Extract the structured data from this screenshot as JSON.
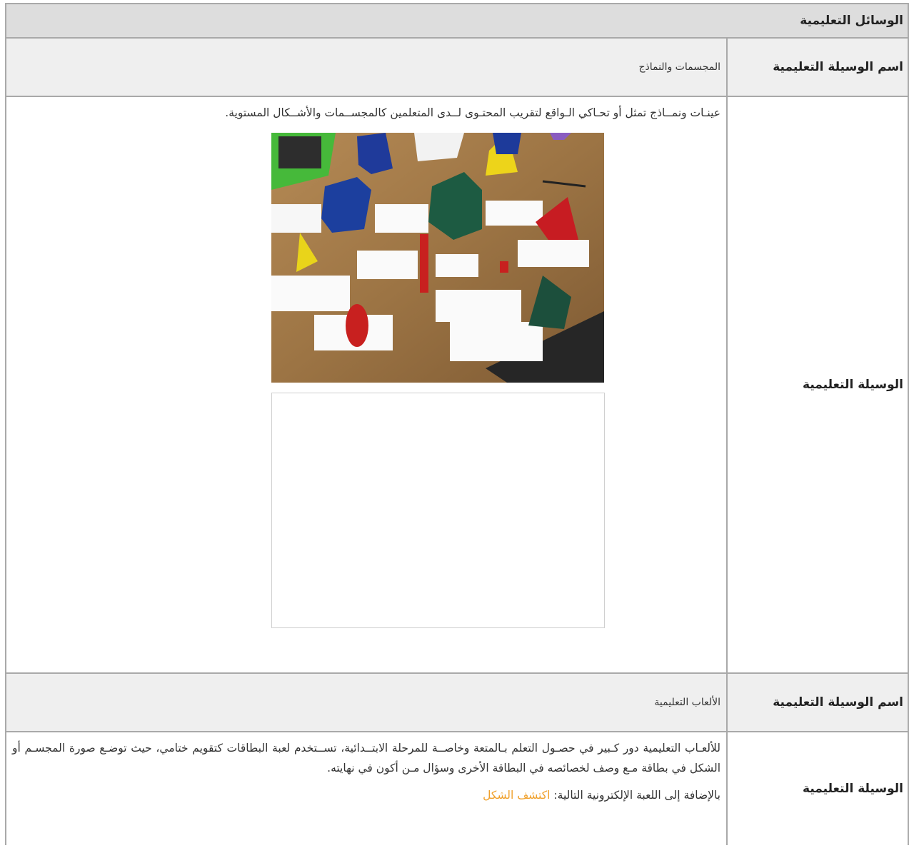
{
  "header": {
    "title": "الوسائل التعليمية"
  },
  "section1": {
    "name_label": "اسم الوسيلة التعليمية",
    "name_value": "المجسمات والنماذج",
    "desc_label": "الوسيلة التعليمية",
    "desc_text": "عينـات ونمــاذج تمثل أو تحـاكي الـواقع لتقريب المحتـوى لــدى المتعلمين كالمجســمات والأشــكال المستوية."
  },
  "section2": {
    "name_label": "اسم الوسيلة التعليمية",
    "name_value": "الألعاب التعليمية",
    "desc_label": "الوسيلة التعليمية",
    "desc_text": "للألعـاب التعليمية دور كـبير في حصـول التعلم بـالمتعة وخاصــة للمرحلة الابتــدائية، تســتخدم لعبة البطاقات كتقويم ختامي، حيث توضـع صورة المجسـم أو الشكل في بطاقة مـع وصف لخصائصه في البطاقة الأخرى وسؤال مـن أكون في نهايته.",
    "extra_prefix": "بالإضافة إلى اللعبة الإلكترونية التالية: ",
    "link_text": "اكتشف الشكل"
  },
  "colors": {
    "header_bg": "#dddddd",
    "row_bg": "#efefef",
    "border": "#a9a9a9",
    "link": "#f0a02a"
  },
  "icons": {
    "photo": "geometric-solids-photo"
  }
}
